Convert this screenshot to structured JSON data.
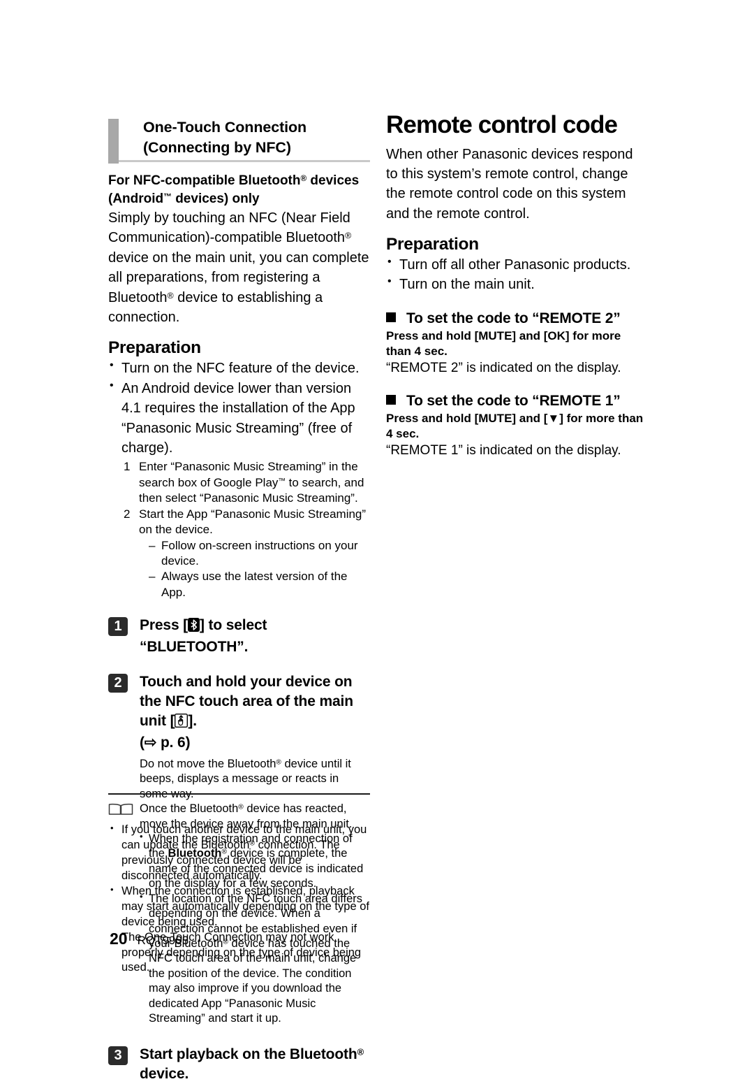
{
  "page": {
    "number": "20",
    "doc_code": "RQT9903"
  },
  "left_column": {
    "section_heading": {
      "line1": "One-Touch Connection",
      "line2": "(Connecting by NFC)"
    },
    "lead_bold": {
      "line1_a": "For NFC-compatible Bluetooth",
      "line1_b": " devices",
      "line2_a": "(Android",
      "line2_b": " devices) only"
    },
    "intro_paragraph": "Simply by touching an NFC (Near Field Communication)-compatible Bluetooth device on the main unit, you can complete all preparations, from registering a Bluetooth device to establishing a connection.",
    "intro_runs": {
      "r1": "Simply by touching an NFC (Near Field Communication)-compatible Bluetooth",
      "r2": " device on the main unit, you can complete all preparations, from registering a Bluetooth",
      "r3": " device to establishing a connection."
    },
    "preparation_title": "Preparation",
    "preparation_bullets": [
      "Turn on the NFC feature of the device.",
      "An Android device lower than version 4.1 requires the installation of the App “Panasonic Music Streaming” (free of charge)."
    ],
    "sub_steps": [
      {
        "number": "1",
        "text_a": "Enter “Panasonic Music Streaming” in the search box of Google Play",
        "text_b": " to search, and then select “Panasonic Music Streaming”."
      },
      {
        "number": "2",
        "text_a": "Start the App “Panasonic Music Streaming” on the device.",
        "text_b": ""
      }
    ],
    "sub_dashes": [
      "Follow on-screen instructions on your device.",
      "Always use the latest version of the App."
    ],
    "steps": [
      {
        "number": "1",
        "text_before": "Press [",
        "icon": "bluetooth-icon",
        "text_after": "] to select “BLUETOOTH”."
      },
      {
        "number": "2",
        "text_before": "Touch and hold your device on the NFC touch area of the main unit [",
        "icon": "nfc-touch-icon",
        "text_after": "].",
        "page_ref_arrow": "⇨",
        "page_ref": "p. 6"
      },
      {
        "number": "3",
        "text_before": "Start playback on the Bluetooth",
        "icon": "",
        "text_after": " device."
      }
    ],
    "step2_notes": {
      "para1_a": "Do not move the Bluetooth",
      "para1_b": " device until it beeps, displays a message or reacts in some way.",
      "para2_a": "Once the Bluetooth",
      "para2_b": " device has reacted, move the device away from the main unit.",
      "bullets": [
        {
          "a": "When the registration and connection of the ",
          "bold": "Bluetooth",
          "b": " device is complete, the name of the connected device is indicated on the display for a few seconds."
        },
        {
          "a": "The location of the NFC touch area differs depending on the device. When a connection cannot be established even if your Bluetooth",
          "bold": "",
          "b": " device has touched the NFC touch area of the main unit, change the position of the device. The condition may also improve if you download the dedicated App “Panasonic Music Streaming” and start it up."
        }
      ]
    },
    "note_block": {
      "icon": "open-book-icon",
      "bullets": [
        {
          "a": "If you touch another device to the main unit, you can update the Bluetooth",
          "b": " connection. The previously connected device will be disconnected automatically."
        },
        {
          "a": "When the connection is established, playback may start automatically depending on the type of device being used.",
          "b": ""
        },
        {
          "a": "The One-Touch Connection may not work properly depending on the type of device being used.",
          "b": ""
        }
      ]
    }
  },
  "right_column": {
    "chapter_title": "Remote control code",
    "intro_paragraph": "When other Panasonic devices respond to this system’s remote control, change the remote control code on this system and the remote control.",
    "preparation_title": "Preparation",
    "preparation_bullets": [
      "Turn off all other Panasonic products.",
      "Turn on the main unit."
    ],
    "subsections": [
      {
        "heading": "To set the code to “REMOTE 2”",
        "press_line": "Press and hold [MUTE] and [OK] for more than 4 sec.",
        "indicated": "“REMOTE 2” is indicated on the display."
      },
      {
        "heading": "To set the code to “REMOTE 1”",
        "press_line_a": "Press and hold [MUTE] and [",
        "press_line_glyph": "▼",
        "press_line_b": "] for more than 4 sec.",
        "press_line": "Press and hold [MUTE] and [▼] for more than 4 sec.",
        "indicated": "“REMOTE 1” is indicated on the display."
      }
    ]
  },
  "symbols": {
    "registered": "®",
    "trademark": "™",
    "bullet": "•",
    "dash": "–",
    "arrow_right": "⇨",
    "black_square": "■",
    "down_triangle": "▼"
  }
}
